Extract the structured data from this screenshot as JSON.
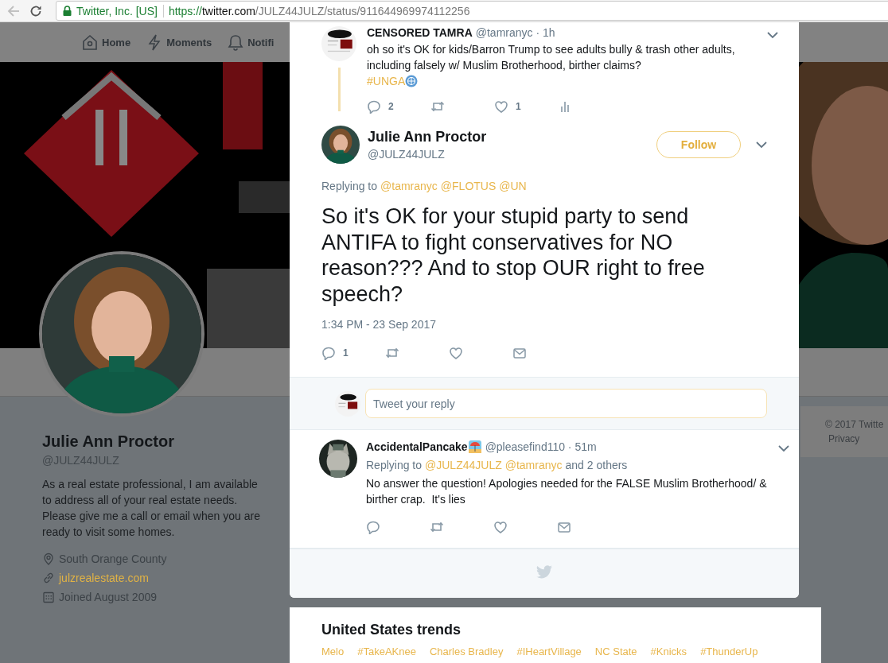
{
  "browser": {
    "site_identity": "Twitter, Inc. [US]",
    "url": {
      "scheme": "https://",
      "host": "twitter.com",
      "path": "/JULZ44JULZ/status/911644969974112256"
    }
  },
  "nav": [
    {
      "kind": "home",
      "label": "Home"
    },
    {
      "kind": "moments",
      "label": "Moments"
    },
    {
      "kind": "notifications",
      "label": "Notifi"
    }
  ],
  "profile": {
    "name": "Julie Ann Proctor",
    "handle": "@JULZ44JULZ",
    "bio": "As a real estate professional, I am available to address all of your real estate needs. Please give me a call or email when you are ready to visit some homes.",
    "details": [
      {
        "kind": "location",
        "text": "South Orange County"
      },
      {
        "kind": "website",
        "text": "julzrealestate.com"
      },
      {
        "kind": "joined",
        "text": "Joined August 2009"
      }
    ]
  },
  "footer_card": {
    "copyright": "© 2017 Twitte",
    "link": "Privacy"
  },
  "modal": {
    "parent_tweet": {
      "name": "CENSORED TAMRA",
      "meta": "@tamranyc · 1h",
      "text": "oh so it's OK for kids/Barron Trump to see adults bully & trash other adults, including falsely w/ Muslim Brotherhood, birther claims?",
      "hashtag": "#UNGA",
      "actions": [
        {
          "kind": "reply",
          "count": "2"
        },
        {
          "kind": "retweet"
        },
        {
          "kind": "like",
          "count": "1"
        },
        {
          "kind": "analytics"
        }
      ]
    },
    "main_tweet": {
      "name": "Julie Ann Proctor",
      "handle": "@JULZ44JULZ",
      "follow": "Follow",
      "replying_label": "Replying to",
      "mentions": [
        "@tamranyc",
        "@FLOTUS",
        "@UN"
      ],
      "text": "So it's OK for your stupid party to send ANTIFA to fight conservatives for NO reason??? And to stop OUR right to free speech?",
      "timestamp": "1:34 PM - 23 Sep 2017",
      "actions": [
        {
          "kind": "reply",
          "count": "1"
        },
        {
          "kind": "retweet"
        },
        {
          "kind": "like"
        },
        {
          "kind": "message"
        }
      ]
    },
    "reply_box": {
      "placeholder": "Tweet your reply"
    },
    "replies": [
      {
        "name": "AccidentalPancake",
        "meta": "@pleasefind110 · 51m",
        "replying_label": "Replying to",
        "mentions": [
          "@JULZ44JULZ",
          "@tamranyc"
        ],
        "others": "and 2 others",
        "text": "No answer the question! Apologies needed for the FALSE Muslim Brotherhood/ & birther crap.  It's lies",
        "actions": [
          {
            "kind": "reply"
          },
          {
            "kind": "retweet"
          },
          {
            "kind": "like"
          },
          {
            "kind": "message"
          }
        ]
      }
    ]
  },
  "trends": {
    "title": "United States trends",
    "items": [
      "Melo",
      "#TakeAKnee",
      "Charles Bradley",
      "#IHeartVillage",
      "NC State",
      "#Knicks",
      "#ThunderUp"
    ]
  }
}
